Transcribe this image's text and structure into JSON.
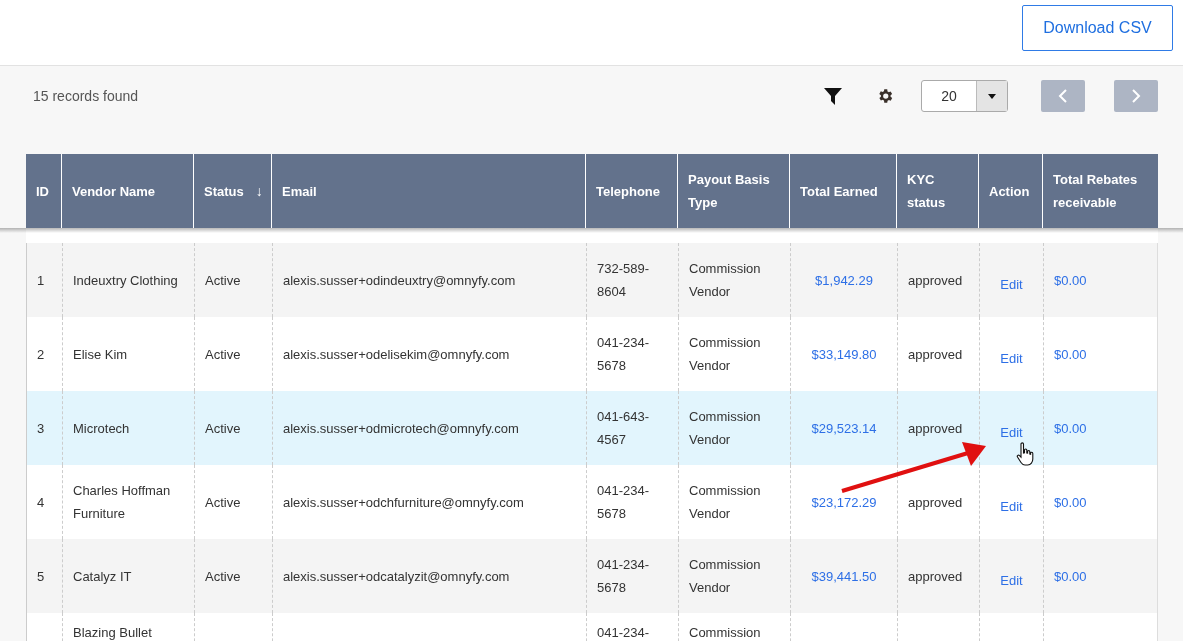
{
  "header": {
    "download_button": "Download CSV"
  },
  "toolbar": {
    "records_count": "15 records found",
    "page_size": "20"
  },
  "table": {
    "columns": [
      {
        "label": "ID"
      },
      {
        "label": "Vendor Name"
      },
      {
        "label": "Status",
        "sort_indicator": "↓"
      },
      {
        "label": "Email"
      },
      {
        "label": "Telephone"
      },
      {
        "label": "Payout Basis Type"
      },
      {
        "label": "Total Earned"
      },
      {
        "label": "KYC status"
      },
      {
        "label": "Action"
      },
      {
        "label": "Total Rebates receivable"
      }
    ],
    "rows": [
      {
        "id": "1",
        "vendor": "Indeuxtry Clothing",
        "status": "Active",
        "email": "alexis.susser+odindeuxtry@omnyfy.com",
        "telephone": "732-589-8604",
        "payout": "Commission Vendor",
        "total_earned": "$1,942.29",
        "kyc": "approved",
        "action": "Edit",
        "rebates": "$0.00",
        "highlighted": false
      },
      {
        "id": "2",
        "vendor": "Elise Kim",
        "status": "Active",
        "email": "alexis.susser+odelisekim@omnyfy.com",
        "telephone": "041-234-5678",
        "payout": "Commission Vendor",
        "total_earned": "$33,149.80",
        "kyc": "approved",
        "action": "Edit",
        "rebates": "$0.00",
        "highlighted": false
      },
      {
        "id": "3",
        "vendor": "Microtech",
        "status": "Active",
        "email": "alexis.susser+odmicrotech@omnyfy.com",
        "telephone": "041-643-4567",
        "payout": "Commission Vendor",
        "total_earned": "$29,523.14",
        "kyc": "approved",
        "action": "Edit",
        "rebates": "$0.00",
        "highlighted": true
      },
      {
        "id": "4",
        "vendor": "Charles Hoffman Furniture",
        "status": "Active",
        "email": "alexis.susser+odchfurniture@omnyfy.com",
        "telephone": "041-234-5678",
        "payout": "Commission Vendor",
        "total_earned": "$23,172.29",
        "kyc": "approved",
        "action": "Edit",
        "rebates": "$0.00",
        "highlighted": false
      },
      {
        "id": "5",
        "vendor": "Catalyz IT",
        "status": "Active",
        "email": "alexis.susser+odcatalyzit@omnyfy.com",
        "telephone": "041-234-5678",
        "payout": "Commission Vendor",
        "total_earned": "$39,441.50",
        "kyc": "approved",
        "action": "Edit",
        "rebates": "$0.00",
        "highlighted": false
      },
      {
        "vendor": "Blazing Bullet",
        "telephone": "041-234-",
        "payout": "Commission",
        "highlighted": false
      }
    ]
  }
}
